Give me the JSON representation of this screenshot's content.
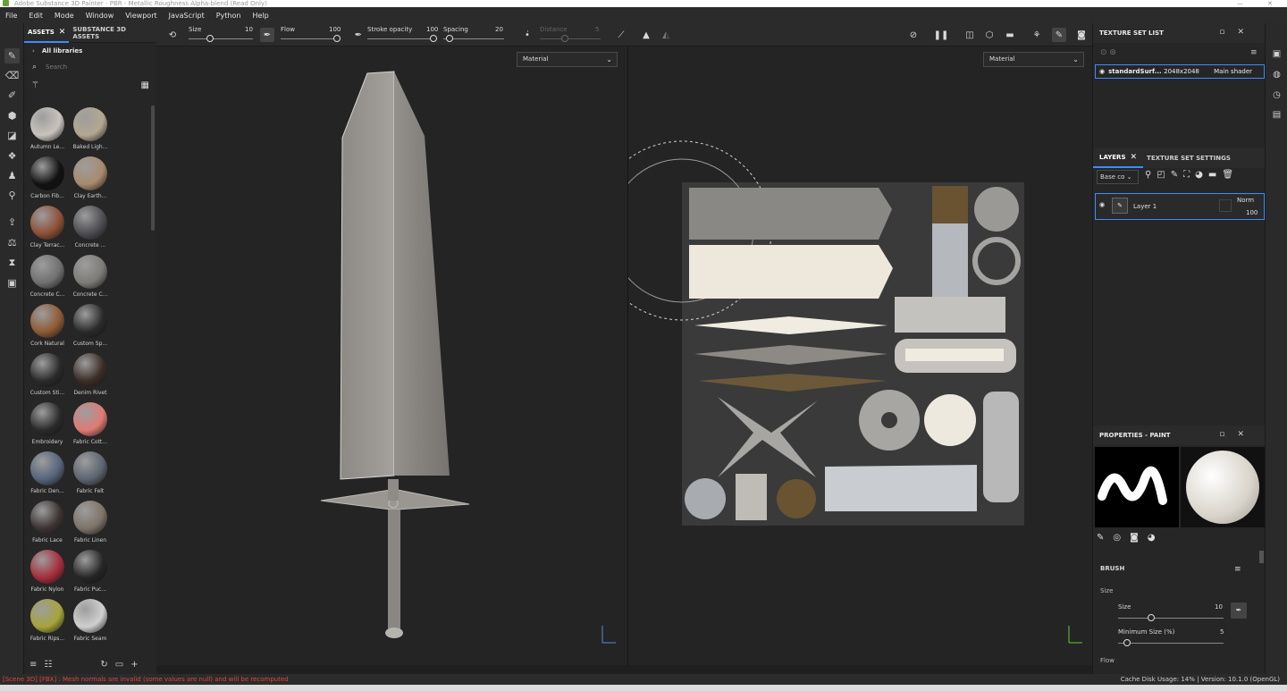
{
  "window": {
    "title": "Adobe Substance 3D Painter - PBR - Metallic Roughness Alpha-blend (Read Only)"
  },
  "menu": [
    "File",
    "Edit",
    "Mode",
    "Window",
    "Viewport",
    "JavaScript",
    "Python",
    "Help"
  ],
  "assets_panel": {
    "tabs": [
      {
        "label": "ASSETS"
      },
      {
        "label": "SUBSTANCE 3D ASSETS"
      }
    ],
    "library": "All libraries",
    "search_placeholder": "Search",
    "items": [
      {
        "label": "Autumn Le...",
        "color": "#c9c3bd"
      },
      {
        "label": "Baked Ligh...",
        "color": "#b4a792"
      },
      {
        "label": "Carbon Fib...",
        "color": "#111111"
      },
      {
        "label": "Clay Earth...",
        "color": "#a88a6e"
      },
      {
        "label": "Clay Terrac...",
        "color": "#8e4f36"
      },
      {
        "label": "Concrete ...",
        "color": "#4d4d52"
      },
      {
        "label": "Concrete C...",
        "color": "#707070"
      },
      {
        "label": "Concrete C...",
        "color": "#7d7b77"
      },
      {
        "label": "Cork Natural",
        "color": "#8d5a34"
      },
      {
        "label": "Custom Sp...",
        "color": "#2a2a2a"
      },
      {
        "label": "Custom Sti...",
        "color": "#2a2a2a"
      },
      {
        "label": "Denim Rivet",
        "color": "#3a2d26"
      },
      {
        "label": "Embroidery",
        "color": "#2a2a2a"
      },
      {
        "label": "Fabric Cott...",
        "color": "#e07a73"
      },
      {
        "label": "Fabric Den...",
        "color": "#56637a"
      },
      {
        "label": "Fabric Felt",
        "color": "#5c6470"
      },
      {
        "label": "Fabric Lace",
        "color": "#3c3232"
      },
      {
        "label": "Fabric Linen",
        "color": "#7d7368"
      },
      {
        "label": "Fabric Nylon",
        "color": "#a52e3c"
      },
      {
        "label": "Fabric Puc...",
        "color": "#262626"
      },
      {
        "label": "Fabric Rips...",
        "color": "#a6a43a"
      },
      {
        "label": "Fabric Seam",
        "color": "#cfcfcf"
      }
    ]
  },
  "toolbar": {
    "size_label": "Size",
    "size_value": "10",
    "flow_label": "Flow",
    "flow_value": "100",
    "stroke_opacity_label": "Stroke opacity",
    "stroke_opacity_value": "100",
    "spacing_label": "Spacing",
    "spacing_value": "20",
    "distance_label": "Distance",
    "distance_value": "5"
  },
  "viewport3d": {
    "mode": "Material"
  },
  "viewport2d": {
    "mode": "Material"
  },
  "texture_set_list": {
    "title": "TEXTURE SET LIST",
    "row": {
      "name": "standardSurf...",
      "resolution": "2048x2048",
      "shader": "Main shader"
    }
  },
  "layers": {
    "tabs": [
      {
        "label": "LAYERS"
      },
      {
        "label": "TEXTURE SET SETTINGS"
      }
    ],
    "channel": "Base co",
    "layer": {
      "name": "Layer 1",
      "blend": "Norm",
      "opacity": "100"
    }
  },
  "properties": {
    "title": "PROPERTIES - PAINT",
    "section": "BRUSH",
    "group": "Size",
    "size_label": "Size",
    "size_value": "10",
    "min_size_label": "Minimum Size (%)",
    "min_size_value": "5",
    "flow_label": "Flow"
  },
  "status": {
    "error": "[Scene 3D] [FBX] : Mesh normals are invalid (some values are null) and will be recomputed",
    "cache": "Cache Disk Usage:   14% | Version: 10.1.0 (OpenGL)"
  }
}
